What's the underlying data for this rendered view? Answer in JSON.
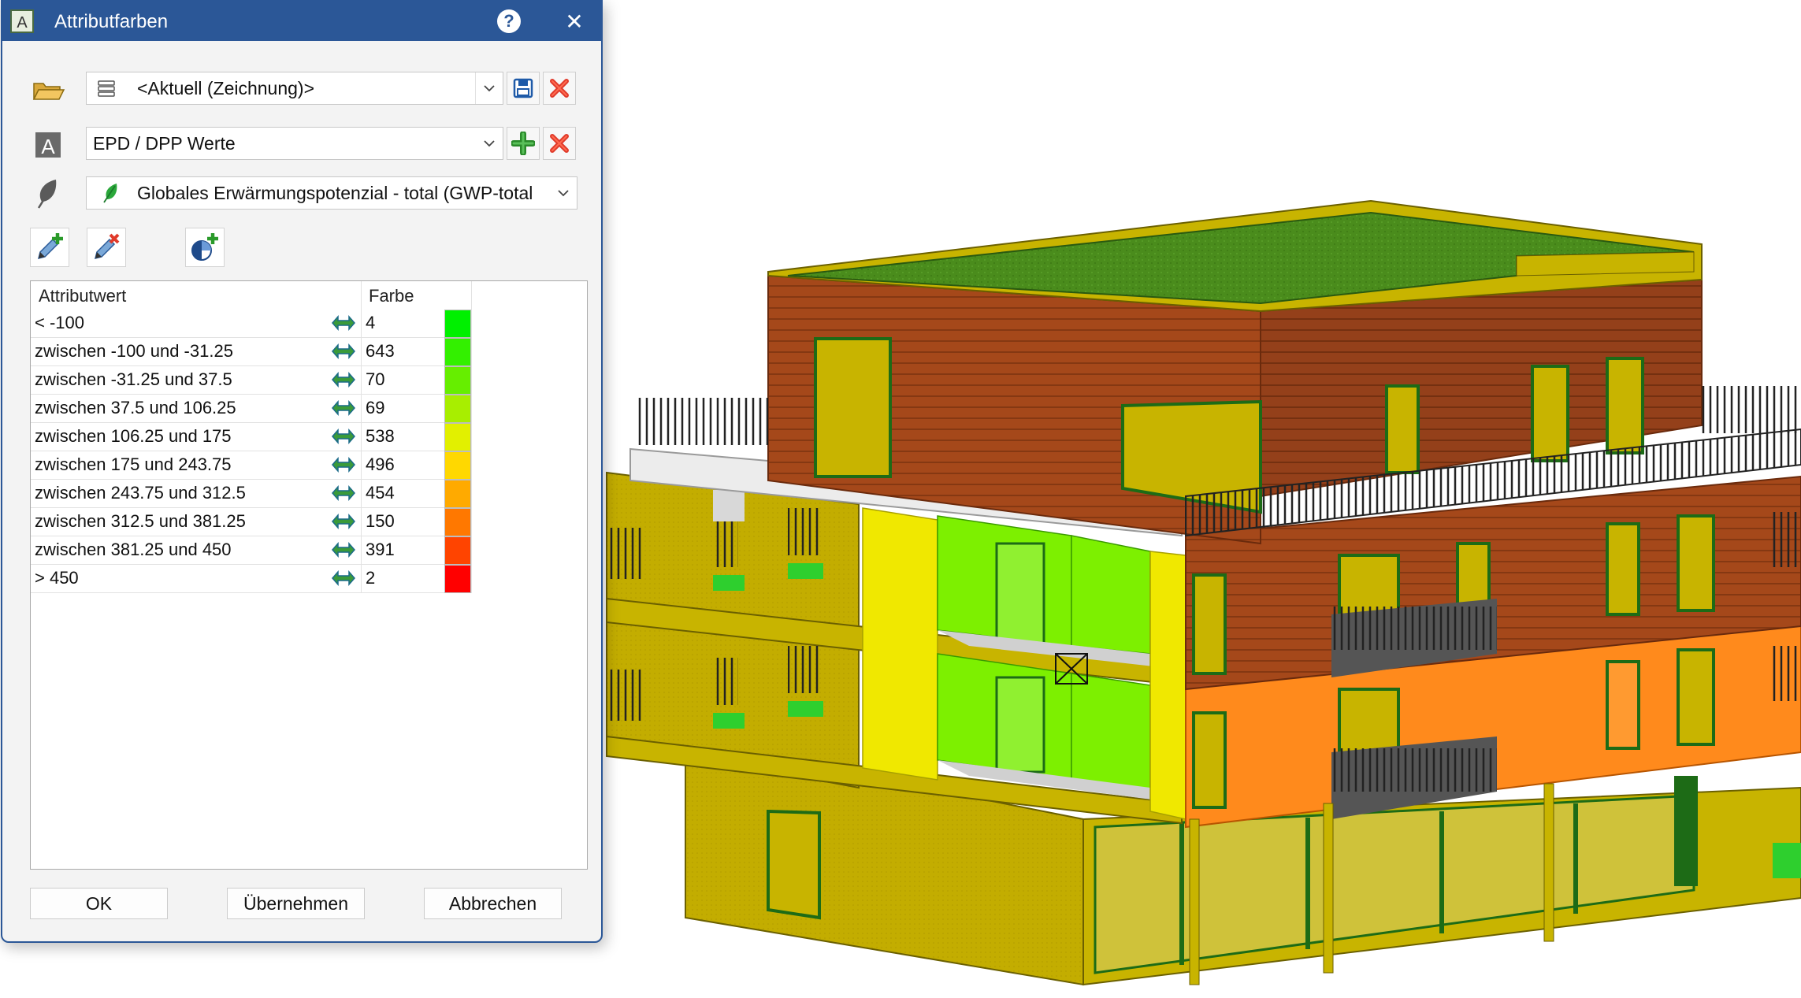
{
  "dialog": {
    "title": "Attributfarben",
    "help_glyph": "?",
    "close_glyph": "✕",
    "colors": {
      "titlebar": "#2b5797",
      "accent": "#2b5797"
    }
  },
  "rows": {
    "favorite_set": {
      "value": "<Aktuell (Zeichnung)>",
      "icons": [
        "folder-open-icon",
        "database-icon",
        "save-icon",
        "delete-icon"
      ]
    },
    "attribute_set": {
      "value": "EPD / DPP Werte",
      "icons": [
        "attribute-letter-icon",
        "add-icon",
        "delete-icon"
      ]
    },
    "attribute": {
      "value": "Globales Erwärmungspotenzial - total (GWP-total",
      "icons": [
        "leaf-icon",
        "leaf-green-icon"
      ]
    }
  },
  "toolbar": {
    "icons": [
      "add-color-pen-icon",
      "remove-color-pen-icon",
      "add-color-scheme-icon"
    ]
  },
  "table": {
    "headers": {
      "attribute": "Attributwert",
      "color": "Farbe"
    },
    "rows": [
      {
        "attribute": "< -100",
        "count": "4",
        "color": "#00f000"
      },
      {
        "attribute": "zwischen -100 und -31.25",
        "count": "643",
        "color": "#33f000"
      },
      {
        "attribute": "zwischen -31.25 und 37.5",
        "count": "70",
        "color": "#66ee00"
      },
      {
        "attribute": "zwischen 37.5 und 106.25",
        "count": "69",
        "color": "#a8ee00"
      },
      {
        "attribute": "zwischen 106.25 und 175",
        "count": "538",
        "color": "#e2f000"
      },
      {
        "attribute": "zwischen 175 und 243.75",
        "count": "496",
        "color": "#ffd800"
      },
      {
        "attribute": "zwischen 243.75 und 312.5",
        "count": "454",
        "color": "#ffaa00"
      },
      {
        "attribute": "zwischen 312.5 und 381.25",
        "count": "150",
        "color": "#ff7800"
      },
      {
        "attribute": "zwischen 381.25 und 450",
        "count": "391",
        "color": "#ff4400"
      },
      {
        "attribute": "> 450",
        "count": "2",
        "color": "#ff0000"
      }
    ]
  },
  "buttons": {
    "ok": "OK",
    "apply": "Übernehmen",
    "cancel": "Abbrechen"
  },
  "scene": {
    "description_icons": [
      "building-model-3d"
    ],
    "colors": {
      "roof_green": "#4a8c1c",
      "facade_brown": "#a5481a",
      "facade_orange": "#ff8a1c",
      "slab_olive": "#c8b400",
      "wall_yellow": "#f0e800",
      "wall_green": "#7df000"
    }
  }
}
